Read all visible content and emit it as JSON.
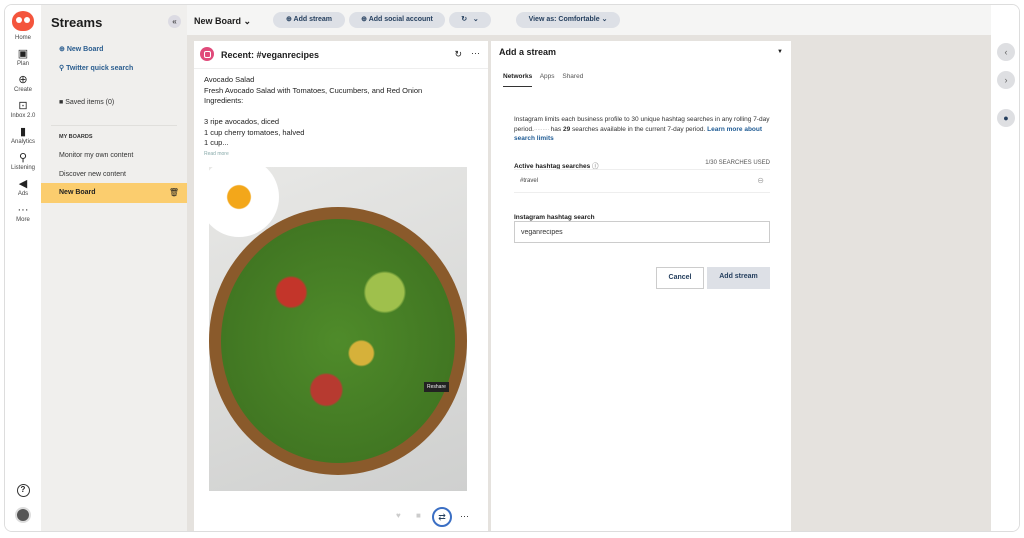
{
  "nav": {
    "items": [
      {
        "label": "Home",
        "icon": "owl-logo"
      },
      {
        "label": "Plan",
        "icon": "calendar-icon"
      },
      {
        "label": "Create",
        "icon": "plus-circle-icon"
      },
      {
        "label": "Inbox 2.0",
        "icon": "inbox-icon"
      },
      {
        "label": "Analytics",
        "icon": "bar-chart-icon"
      },
      {
        "label": "Listening",
        "icon": "location-pin-icon"
      },
      {
        "label": "Ads",
        "icon": "megaphone-icon"
      },
      {
        "label": "More",
        "icon": "ellipsis-icon"
      }
    ],
    "help": "?"
  },
  "streams": {
    "title": "Streams",
    "new_board": "New Board",
    "twitter_search": "Twitter quick search",
    "saved_items": "Saved items (0)",
    "my_boards_heading": "MY BOARDS",
    "boards": [
      "Monitor my own content",
      "Discover new content",
      "New Board"
    ]
  },
  "topbar": {
    "board_title": "New Board",
    "add_stream": "Add stream",
    "add_social_account": "Add social account",
    "view_as": "View as: Comfortable"
  },
  "stream": {
    "title": "Recent: #veganrecipes",
    "post_lines": [
      "Avocado Salad",
      "Fresh Avocado Salad with Tomatoes, Cucumbers, and Red Onion",
      "Ingredients:",
      "",
      "3 ripe avocados, diced",
      "1 cup cherry tomatoes, halved",
      "1 cup..."
    ],
    "read_more": "Read more",
    "reshare_tooltip": "Reshare"
  },
  "panel": {
    "title": "Add a stream",
    "tabs": [
      "Networks",
      "Apps",
      "Shared"
    ],
    "info_1": "Instagram limits each business profile to 30 unique hashtag searches in any rolling 7-day period.",
    "info_has": " has ",
    "info_count": "29",
    "info_2": " searches available in the current 7-day period. ",
    "info_link": "Learn more about search limits",
    "active_label": "Active hashtag searches",
    "used": "1/30 SEARCHES USED",
    "active_tags": [
      "#travel"
    ],
    "search_label": "Instagram hashtag search",
    "search_value": "veganrecipes",
    "cancel": "Cancel",
    "add": "Add stream"
  },
  "colors": {
    "accent": "#fbcd6e",
    "brand": "#f4553d",
    "link": "#2a5d8f"
  }
}
